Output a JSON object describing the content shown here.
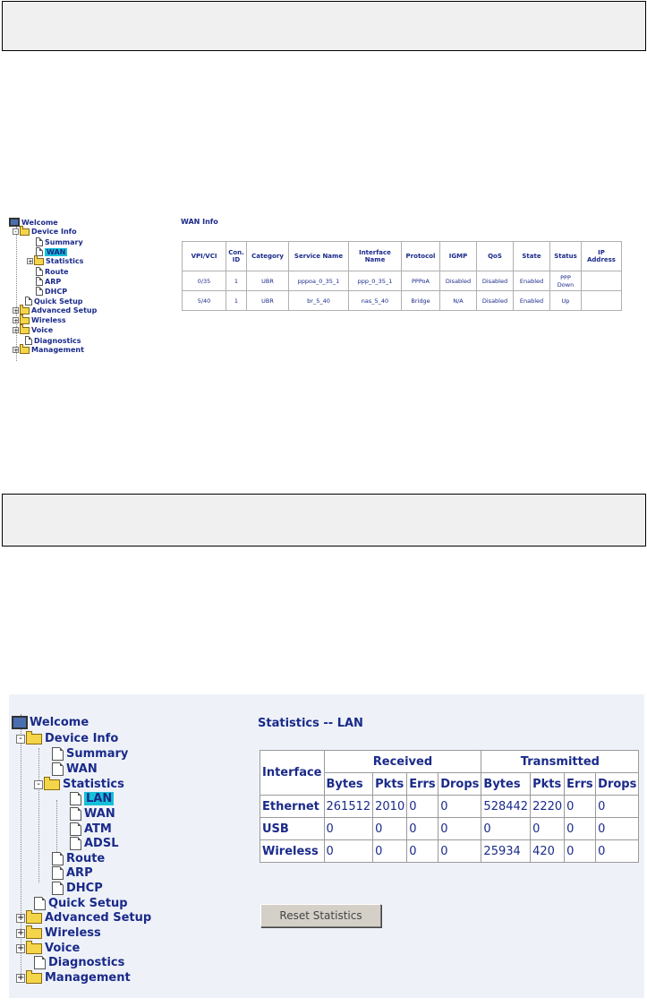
{
  "small_ui": {
    "tree": {
      "welcome": "Welcome",
      "device_info": "Device Info",
      "summary": "Summary",
      "wan": "WAN",
      "statistics": "Statistics",
      "route": "Route",
      "arp": "ARP",
      "dhcp": "DHCP",
      "quick_setup": "Quick Setup",
      "advanced_setup": "Advanced Setup",
      "wireless": "Wireless",
      "voice": "Voice",
      "diagnostics": "Diagnostics",
      "management": "Management"
    },
    "title": "WAN Info",
    "headers": [
      "VPI/VCI",
      "Con. ID",
      "Category",
      "Service Name",
      "Interface Name",
      "Protocol",
      "IGMP",
      "QoS",
      "State",
      "Status",
      "IP Address"
    ],
    "rows": [
      [
        "0/35",
        "1",
        "UBR",
        "pppoa_0_35_1",
        "ppp_0_35_1",
        "PPPoA",
        "Disabled",
        "Disabled",
        "Enabled",
        "PPP Down",
        ""
      ],
      [
        "5/40",
        "1",
        "UBR",
        "br_5_40",
        "nas_5_40",
        "Bridge",
        "N/A",
        "Disabled",
        "Enabled",
        "Up",
        ""
      ]
    ]
  },
  "big_ui": {
    "tree": {
      "welcome": "Welcome",
      "device_info": "Device Info",
      "summary": "Summary",
      "wan": "WAN",
      "statistics": "Statistics",
      "lan": "LAN",
      "stat_wan": "WAN",
      "atm": "ATM",
      "adsl": "ADSL",
      "route": "Route",
      "arp": "ARP",
      "dhcp": "DHCP",
      "quick_setup": "Quick Setup",
      "advanced_setup": "Advanced Setup",
      "wireless": "Wireless",
      "voice": "Voice",
      "diagnostics": "Diagnostics",
      "management": "Management"
    },
    "title": "Statistics -- LAN",
    "table": {
      "interface_label": "Interface",
      "received_label": "Received",
      "transmitted_label": "Transmitted",
      "sub_headers": [
        "Bytes",
        "Pkts",
        "Errs",
        "Drops",
        "Bytes",
        "Pkts",
        "Errs",
        "Drops"
      ],
      "rows": [
        {
          "name": "Ethernet",
          "values": [
            "261512",
            "2010",
            "0",
            "0",
            "528442",
            "2220",
            "0",
            "0"
          ]
        },
        {
          "name": "USB",
          "values": [
            "0",
            "0",
            "0",
            "0",
            "0",
            "0",
            "0",
            "0"
          ]
        },
        {
          "name": "Wireless",
          "values": [
            "0",
            "0",
            "0",
            "0",
            "25934",
            "420",
            "0",
            "0"
          ]
        }
      ]
    },
    "reset_button": "Reset Statistics"
  },
  "colors": {
    "link_text": "#1a2a8a",
    "selected": "#14c0d8",
    "panel_bg": "#eef2f8"
  }
}
